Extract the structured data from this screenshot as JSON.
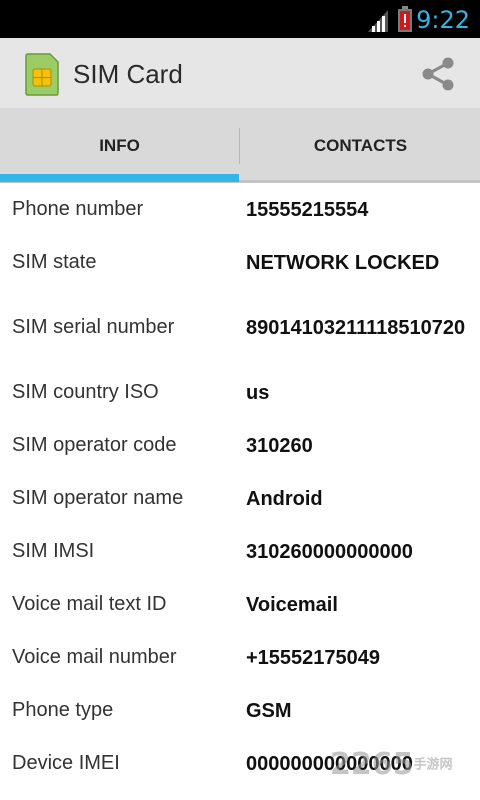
{
  "status_bar": {
    "time": "9:22"
  },
  "action_bar": {
    "title": "SIM Card",
    "icons": [
      "sim-card-icon",
      "share-icon"
    ]
  },
  "tabs": [
    {
      "label": "INFO",
      "selected": true
    },
    {
      "label": "CONTACTS",
      "selected": false
    }
  ],
  "colors": {
    "accent": "#33b5e5",
    "action_bar": "#e6e6e6",
    "tab_bar": "#d9d9d9"
  },
  "info_rows": [
    {
      "label": "Phone number",
      "value": "15555215554"
    },
    {
      "label": "SIM state",
      "value": "NETWORK LOCKED"
    },
    {
      "label": "SIM serial number",
      "value": "89014103211118510720"
    },
    {
      "label": "SIM country ISO",
      "value": "us"
    },
    {
      "label": "SIM operator code",
      "value": "310260"
    },
    {
      "label": "SIM operator name",
      "value": "Android"
    },
    {
      "label": "SIM IMSI",
      "value": "310260000000000"
    },
    {
      "label": "Voice mail text ID",
      "value": "Voicemail"
    },
    {
      "label": "Voice mail number",
      "value": "+15552175049"
    },
    {
      "label": "Phone type",
      "value": "GSM"
    },
    {
      "label": "Device IMEI",
      "value": "000000000000000"
    }
  ],
  "watermark": {
    "number": "2265",
    "text": "手游网"
  }
}
